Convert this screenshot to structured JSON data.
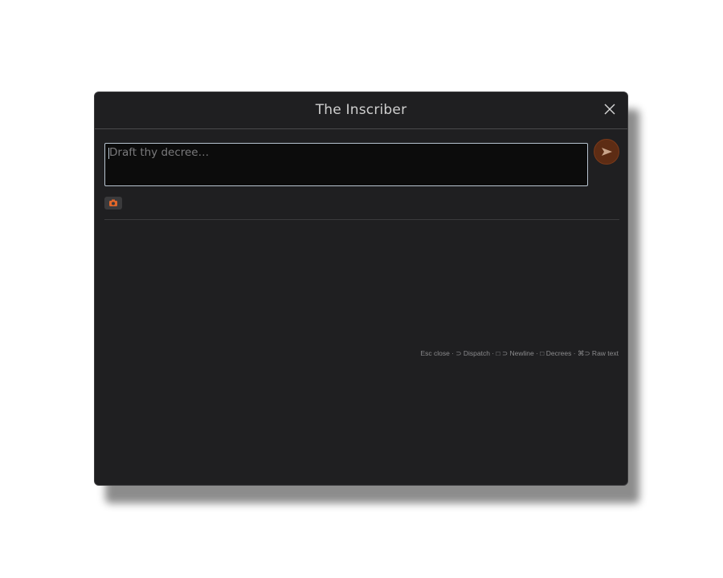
{
  "dialog": {
    "title": "The Inscriber",
    "close_icon": "close-icon",
    "input": {
      "value": "",
      "placeholder": "Draft thy decree…"
    },
    "send_icon": "send-icon",
    "attach_icon": "camera-icon",
    "hints": "Esc close · ⊃ Dispatch · □ ⊃ Newline · □ Decrees · ⌘⊃ Raw text"
  },
  "colors": {
    "background": "#1f1f21",
    "accent": "#5d2c14",
    "input_border": "#b8c4d0"
  }
}
